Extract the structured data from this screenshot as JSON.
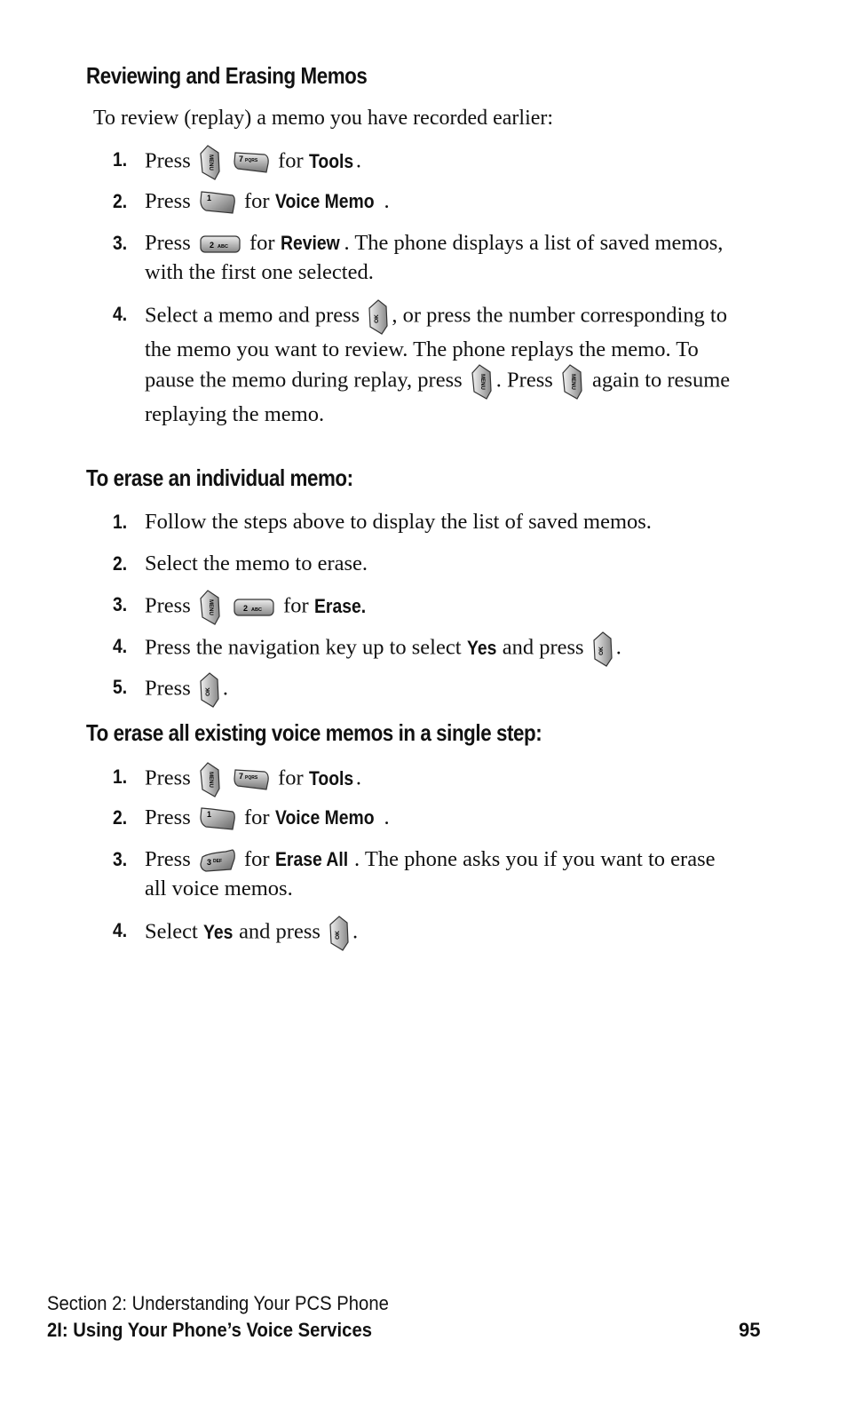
{
  "section1": {
    "heading": "Reviewing and Erasing Memos",
    "intro": "To review (replay) a memo you have recorded earlier:",
    "steps": [
      {
        "num": "1.",
        "pre": "Press",
        "keys": [
          "menu-key",
          "7-pqrs-key"
        ],
        "mid": "for",
        "bold": "Tools",
        "post": "."
      },
      {
        "num": "2.",
        "pre": "Press",
        "keys": [
          "1-key"
        ],
        "mid": "for",
        "bold": "Voice Memo",
        "post": "."
      },
      {
        "num": "3.",
        "pre": "Press",
        "keys": [
          "2-abc-key"
        ],
        "mid": "for",
        "bold": "Review",
        "post": ". The phone displays a list of saved memos, with the first one selected."
      },
      {
        "num": "4.",
        "a": "Select a memo and press",
        "b": ", or press the number corresponding to the memo you want to review. The phone replays the memo. To pause the memo during replay, press",
        "c": ". Press",
        "d": "again to resume replaying the memo."
      }
    ]
  },
  "section2": {
    "heading": "To erase an individual memo:",
    "steps": [
      {
        "num": "1.",
        "text": "Follow the steps above to display the list of saved memos."
      },
      {
        "num": "2.",
        "text": "Select the memo to erase."
      },
      {
        "num": "3.",
        "pre": "Press",
        "mid": "for",
        "bold": "Erase.",
        "post": ""
      },
      {
        "num": "4.",
        "pre": "Press the navigation key up to select",
        "bold": "Yes",
        "mid": "and press",
        "post": "."
      },
      {
        "num": "5.",
        "pre": "Press",
        "post": "."
      }
    ]
  },
  "section3": {
    "heading": "To erase all existing voice memos in a single step:",
    "steps": [
      {
        "num": "1.",
        "pre": "Press",
        "mid": "for",
        "bold": "Tools",
        "post": "."
      },
      {
        "num": "2.",
        "pre": "Press",
        "mid": "for",
        "bold": "Voice Memo",
        "post": "."
      },
      {
        "num": "3.",
        "pre": "Press",
        "mid": "for",
        "bold": "Erase All",
        "post": ". The phone asks you if you want to erase all voice memos."
      },
      {
        "num": "4.",
        "pre": "Select",
        "bold": "Yes",
        "mid": "and press",
        "post": "."
      }
    ]
  },
  "keys": {
    "menu": "MENU",
    "ok": "OK",
    "seven": "7",
    "seven_sub": "PQRS",
    "one": "1",
    "two": "2",
    "two_sub": "ABC",
    "three": "3",
    "three_sub": "DEF"
  },
  "footer": {
    "section": "Section 2: Understanding Your PCS Phone",
    "chapter": "2I: Using Your Phone’s Voice Services",
    "page": "95"
  }
}
